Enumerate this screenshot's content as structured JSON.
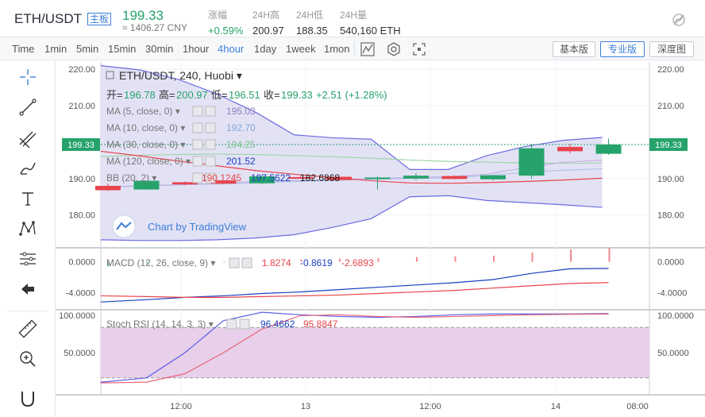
{
  "header": {
    "pair": "ETH/USDT",
    "main_badge": "主板",
    "last_price": "199.33",
    "cny_value": "≈ 1406.27 CNY",
    "stats": [
      {
        "label": "涨幅",
        "value": "+0.59%"
      },
      {
        "label": "24H高",
        "value": "200.97"
      },
      {
        "label": "24H低",
        "value": "188.35"
      },
      {
        "label": "24H量",
        "value": "540,160 ETH"
      }
    ]
  },
  "toolbar": {
    "timeframes": [
      "Time",
      "1min",
      "5min",
      "15min",
      "30min",
      "1hour",
      "4hour",
      "1day",
      "1week",
      "1mon"
    ],
    "active_timeframe": "4hour",
    "versions": [
      "基本版",
      "专业版",
      "深度图"
    ],
    "active_version": "专业版"
  },
  "colors": {
    "up": "#26a36b",
    "down": "#e8444c",
    "accent": "#3d7fd9",
    "bb_fill": "#e3e2f5",
    "stoch_fill": "#e8d0ea"
  },
  "chart_data": [
    {
      "type": "candlestick",
      "title": "ETH/USDT, 240, Huobi",
      "ohlc_label": {
        "open_label": "开=",
        "open": "196.78",
        "high_label": "高=",
        "high": "200.97",
        "low_label": "低=",
        "low": "196.51",
        "close_label": "收=",
        "close": "199.33",
        "change": "+2.51 (+1.28%)"
      },
      "ylim": [
        171,
        222
      ],
      "yticks": [
        "220.00",
        "210.00",
        "190.00",
        "180.00"
      ],
      "last_price_tag": "199.33",
      "x_labels": [
        "12:00",
        "13",
        "12:00",
        "14",
        "08:00"
      ],
      "candles": [
        {
          "t": 0,
          "o": 188.0,
          "h": 188.6,
          "l": 186.6,
          "c": 186.8
        },
        {
          "t": 1,
          "o": 187.0,
          "h": 189.4,
          "l": 186.9,
          "c": 189.4
        },
        {
          "t": 2,
          "o": 189.0,
          "h": 189.2,
          "l": 188.2,
          "c": 188.4
        },
        {
          "t": 3,
          "o": 189.5,
          "h": 189.6,
          "l": 188.4,
          "c": 188.6
        },
        {
          "t": 4,
          "o": 188.7,
          "h": 191.0,
          "l": 188.4,
          "c": 190.6
        },
        {
          "t": 5,
          "o": 190.4,
          "h": 190.8,
          "l": 190.0,
          "c": 190.3
        },
        {
          "t": 6,
          "o": 190.5,
          "h": 190.9,
          "l": 189.5,
          "c": 189.6
        },
        {
          "t": 7,
          "o": 190.0,
          "h": 190.6,
          "l": 187.0,
          "c": 190.3
        },
        {
          "t": 8,
          "o": 190.0,
          "h": 191.5,
          "l": 189.6,
          "c": 190.8
        },
        {
          "t": 9,
          "o": 190.7,
          "h": 190.9,
          "l": 189.7,
          "c": 189.9
        },
        {
          "t": 10,
          "o": 189.8,
          "h": 191.0,
          "l": 189.5,
          "c": 190.9
        },
        {
          "t": 11,
          "o": 190.8,
          "h": 199.5,
          "l": 190.0,
          "c": 198.3
        },
        {
          "t": 12,
          "o": 198.7,
          "h": 199.5,
          "l": 196.9,
          "c": 197.5
        },
        {
          "t": 13,
          "o": 196.8,
          "h": 200.97,
          "l": 196.51,
          "c": 199.33
        }
      ],
      "indicators": [
        {
          "name": "MA (5, close, 0)",
          "value": "195.03",
          "color": "#8e7cc3"
        },
        {
          "name": "MA (10, close, 0)",
          "value": "192.70",
          "color": "#7ea6d9"
        },
        {
          "name": "MA (30, close, 0)",
          "value": "194.25",
          "color": "#77c28a"
        },
        {
          "name": "MA (120, close, 0)",
          "value": "201.52",
          "color": "#1a3fbf"
        },
        {
          "name": "BB (20, 2)",
          "values": [
            "190.1245",
            "197.5622",
            "182.6868"
          ],
          "colors": [
            "#e8444c",
            "#1a3fbf",
            "#1a1a1a"
          ]
        }
      ],
      "bb_upper": [
        221.0,
        219.8,
        217.2,
        213.2,
        208.2,
        202.0,
        201.2,
        200.8,
        192.5,
        192.5,
        196.3,
        198.8,
        200.5,
        201.3
      ],
      "bb_lower": [
        173.2,
        173.0,
        173.0,
        173.2,
        173.7,
        174.6,
        176.6,
        179.0,
        185.0,
        185.3,
        184.0,
        183.4,
        182.8,
        182.1
      ],
      "bb_basis": [
        197.5,
        196.2,
        194.8,
        193.5,
        192.2,
        191.2,
        190.3,
        189.4,
        188.8,
        188.7,
        188.9,
        189.2,
        189.6,
        190.1
      ],
      "ma30": [
        196.0,
        196.4,
        196.6,
        196.7,
        196.6,
        196.3,
        196.0,
        195.6,
        195.1,
        194.7,
        194.5,
        194.3,
        194.2,
        194.25
      ],
      "ma5": [
        187.5,
        188.0,
        188.3,
        188.6,
        189.2,
        189.5,
        189.7,
        190.0,
        190.3,
        190.5,
        191.2,
        193.0,
        194.5,
        195.03
      ],
      "ma10": [
        187.8,
        188.0,
        188.3,
        188.5,
        188.8,
        189.2,
        189.5,
        189.8,
        190.0,
        190.2,
        190.8,
        191.7,
        192.3,
        192.7
      ],
      "ma120": [
        199.6,
        199.8,
        200.0,
        200.3,
        200.5,
        200.7,
        200.9,
        201.0,
        201.1,
        201.2,
        201.3,
        201.4,
        201.5,
        201.52
      ],
      "watermark": "Chart by TradingView"
    },
    {
      "type": "line",
      "title": "MACD (12, 26, close, 9)",
      "values_label": [
        "1.8274",
        "-0.8619",
        "-2.6893"
      ],
      "ylim": [
        -6.0,
        1.6
      ],
      "yticks": [
        "0.0000",
        "-4.0000"
      ],
      "macd": [
        -5.2,
        -4.9,
        -4.6,
        -4.4,
        -4.1,
        -3.9,
        -3.6,
        -3.3,
        -3.0,
        -2.7,
        -2.3,
        -1.5,
        -0.9,
        -0.8619
      ],
      "signal": [
        -4.4,
        -4.5,
        -4.6,
        -4.6,
        -4.5,
        -4.4,
        -4.3,
        -4.1,
        -3.9,
        -3.7,
        -3.4,
        -3.1,
        -2.8,
        -2.6893
      ],
      "histogram": [
        -0.6,
        -0.4,
        -0.2,
        -0.1,
        0.1,
        0.3,
        0.4,
        0.5,
        0.6,
        0.7,
        0.8,
        1.2,
        1.6,
        1.8274
      ]
    },
    {
      "type": "line",
      "title": "Stoch RSI (14, 14, 3, 3)",
      "values_label": [
        "96.4662",
        "95.8847"
      ],
      "ylim": [
        0,
        100
      ],
      "yticks": [
        "100.0000",
        "50.0000"
      ],
      "band": [
        20,
        80
      ],
      "k": [
        15,
        20,
        50,
        88,
        98,
        95,
        93,
        92,
        93,
        95,
        96,
        96,
        96,
        96.4662
      ],
      "d": [
        14,
        15,
        25,
        50,
        78,
        94,
        95,
        93,
        92,
        93,
        94,
        95,
        95.5,
        95.8847
      ]
    }
  ]
}
